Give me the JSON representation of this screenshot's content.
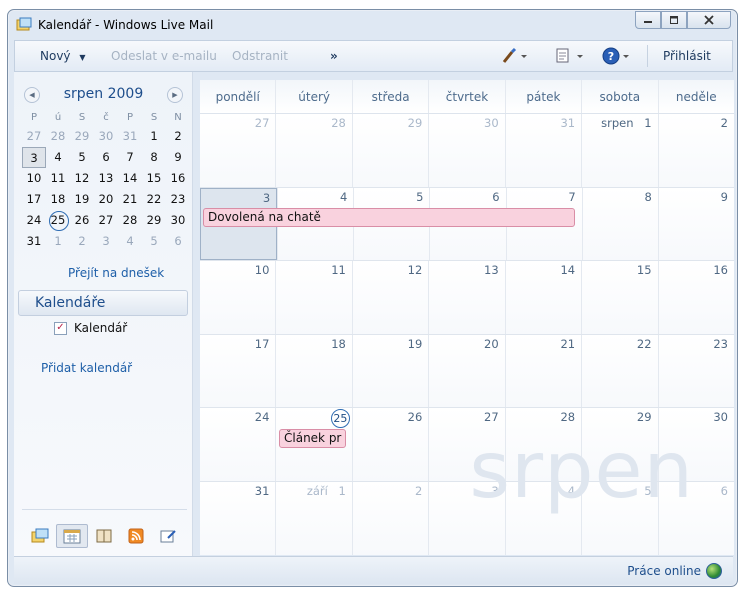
{
  "window": {
    "title": "Kalendář - Windows Live Mail"
  },
  "toolbar": {
    "new_label": "Nový",
    "send_email_label": "Odeslat v e-mailu",
    "delete_label": "Odstranit",
    "more_label": "»",
    "signin_label": "Přihlásit"
  },
  "mini_calendar": {
    "month_title": "srpen 2009",
    "dow": [
      "P",
      "ú",
      "S",
      "č",
      "P",
      "S",
      "N"
    ],
    "weeks": [
      [
        "27",
        "28",
        "29",
        "30",
        "31",
        "1",
        "2"
      ],
      [
        "3",
        "4",
        "5",
        "6",
        "7",
        "8",
        "9"
      ],
      [
        "10",
        "11",
        "12",
        "13",
        "14",
        "15",
        "16"
      ],
      [
        "17",
        "18",
        "19",
        "20",
        "21",
        "22",
        "23"
      ],
      [
        "24",
        "25",
        "26",
        "27",
        "28",
        "29",
        "30"
      ],
      [
        "31",
        "1",
        "2",
        "3",
        "4",
        "5",
        "6"
      ]
    ],
    "go_today_label": "Přejít na dnešek"
  },
  "sidebar": {
    "calendars_header": "Kalendáře",
    "calendar_item": "Kalendář",
    "add_calendar_label": "Přidat kalendář"
  },
  "calendar": {
    "day_names": [
      "pondělí",
      "úterý",
      "středa",
      "čtvrtek",
      "pátek",
      "sobota",
      "neděle"
    ],
    "weeks": [
      [
        "27",
        "28",
        "29",
        "30",
        "31",
        "1",
        "2"
      ],
      [
        "3",
        "4",
        "5",
        "6",
        "7",
        "8",
        "9"
      ],
      [
        "10",
        "11",
        "12",
        "13",
        "14",
        "15",
        "16"
      ],
      [
        "17",
        "18",
        "19",
        "20",
        "21",
        "22",
        "23"
      ],
      [
        "24",
        "25",
        "26",
        "27",
        "28",
        "29",
        "30"
      ],
      [
        "31",
        "1",
        "2",
        "3",
        "4",
        "5",
        "6"
      ]
    ],
    "month_labels": {
      "aug_first": "srpen",
      "sep_first": "září"
    },
    "watermark": "srpen",
    "events": {
      "vacation": "Dovolená na chatě",
      "article": "Článek pr"
    }
  },
  "status": {
    "online_label": "Práce online"
  },
  "colors": {
    "event_fill": "#f9d2de",
    "event_border": "#d98ea6",
    "accent": "#1e5fa8"
  }
}
